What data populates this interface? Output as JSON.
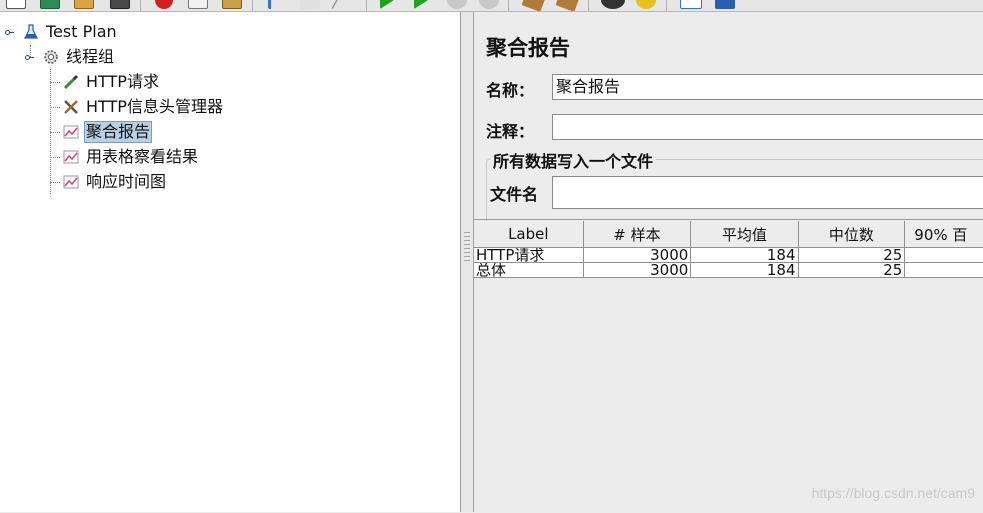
{
  "toolbar": {
    "buttons": [
      {
        "name": "new-icon",
        "color": "#ffffff"
      },
      {
        "name": "templates-icon",
        "color": "#2e8b57"
      },
      {
        "name": "open-icon",
        "color": "#d9a441"
      },
      {
        "name": "save-icon",
        "color": "#4a4a4a"
      },
      {
        "name": "cut-icon",
        "color": "#d02020"
      },
      {
        "name": "copy-icon",
        "color": "#f2f2f2"
      },
      {
        "name": "paste-icon",
        "color": "#c8a04a"
      },
      {
        "name": "expand-icon",
        "color": "#3a6fd0"
      },
      {
        "name": "collapse-icon",
        "color": "#e0e0e0"
      },
      {
        "name": "toggle-icon",
        "color": "#9a9a9a"
      },
      {
        "name": "start-icon",
        "color": "#22a022"
      },
      {
        "name": "start-no-pauses-icon",
        "color": "#22a022"
      },
      {
        "name": "stop-icon",
        "color": "#c8c8c8"
      },
      {
        "name": "shutdown-icon",
        "color": "#c8c8c8"
      },
      {
        "name": "clear-icon",
        "color": "#b07a3a"
      },
      {
        "name": "clear-all-icon",
        "color": "#b07a3a"
      },
      {
        "name": "search-icon",
        "color": "#333333"
      },
      {
        "name": "reset-search-icon",
        "color": "#e8c020"
      },
      {
        "name": "function-helper-icon",
        "color": "#3a6fd0"
      },
      {
        "name": "help-icon",
        "color": "#2a5fb0"
      }
    ]
  },
  "tree": {
    "nodes": [
      {
        "label": "Test Plan",
        "icon": "flask-icon"
      },
      {
        "label": "线程组",
        "icon": "gear-icon"
      },
      {
        "label": "HTTP请求",
        "icon": "pipette-icon"
      },
      {
        "label": "HTTP信息头管理器",
        "icon": "tools-icon"
      },
      {
        "label": "聚合报告",
        "icon": "graph-icon"
      },
      {
        "label": "用表格察看结果",
        "icon": "graph-icon"
      },
      {
        "label": "响应时间图",
        "icon": "graph-icon"
      }
    ]
  },
  "panel": {
    "title": "聚合报告",
    "name_label": "名称：",
    "name_value": "聚合报告",
    "comment_label": "注释：",
    "comment_value": "",
    "file_group_title": "所有数据写入一个文件",
    "filename_label": "文件名",
    "filename_value": ""
  },
  "table": {
    "columns": [
      "Label",
      "# 样本",
      "平均值",
      "中位数",
      "90% 百"
    ],
    "rows": [
      {
        "label": "HTTP请求",
        "samples": "3000",
        "average": "184",
        "median": "25",
        "p90": ""
      },
      {
        "label": "总体",
        "samples": "3000",
        "average": "184",
        "median": "25",
        "p90": ""
      }
    ]
  },
  "watermark": "https://blog.csdn.net/cam9"
}
